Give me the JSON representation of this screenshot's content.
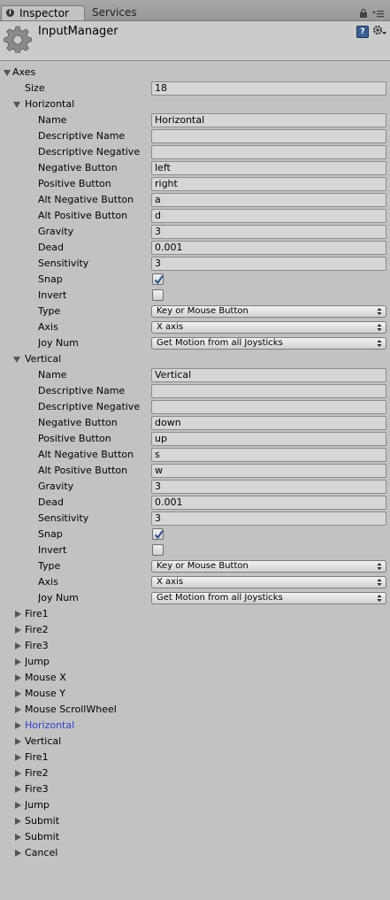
{
  "tabs": {
    "inspector": "Inspector",
    "services": "Services"
  },
  "header": {
    "title": "InputManager"
  },
  "axes": {
    "label": "Axes",
    "size_label": "Size",
    "size_value": "18",
    "expanded": [
      {
        "name": "Horizontal",
        "fields": {
          "name": "Horizontal",
          "descriptive_name": "",
          "descriptive_negative_name": "",
          "negative_button": "left",
          "positive_button": "right",
          "alt_negative_button": "a",
          "alt_positive_button": "d",
          "gravity": "3",
          "dead": "0.001",
          "sensitivity": "3",
          "snap": true,
          "invert": false,
          "type": "Key or Mouse Button",
          "axis": "X axis",
          "joy_num": "Get Motion from all Joysticks"
        }
      },
      {
        "name": "Vertical",
        "fields": {
          "name": "Vertical",
          "descriptive_name": "",
          "descriptive_negative_name": "",
          "negative_button": "down",
          "positive_button": "up",
          "alt_negative_button": "s",
          "alt_positive_button": "w",
          "gravity": "3",
          "dead": "0.001",
          "sensitivity": "3",
          "snap": true,
          "invert": false,
          "type": "Key or Mouse Button",
          "axis": "X axis",
          "joy_num": "Get Motion from all Joysticks"
        }
      }
    ],
    "collapsed": [
      "Fire1",
      "Fire2",
      "Fire3",
      "Jump",
      "Mouse X",
      "Mouse Y",
      "Mouse ScrollWheel",
      "Horizontal",
      "Vertical",
      "Fire1",
      "Fire2",
      "Fire3",
      "Jump",
      "Submit",
      "Submit",
      "Cancel"
    ],
    "active_collapsed_index": 7
  },
  "field_labels": {
    "name": "Name",
    "descriptive_name": "Descriptive Name",
    "descriptive_negative_name": "Descriptive Negative Name",
    "negative_button": "Negative Button",
    "positive_button": "Positive Button",
    "alt_negative_button": "Alt Negative Button",
    "alt_positive_button": "Alt Positive Button",
    "gravity": "Gravity",
    "dead": "Dead",
    "sensitivity": "Sensitivity",
    "snap": "Snap",
    "invert": "Invert",
    "type": "Type",
    "axis": "Axis",
    "joy_num": "Joy Num"
  },
  "colors": {
    "background": "#c2c2c2",
    "active_label": "#2c3fd0",
    "checkbox_check": "#2d4f8e"
  }
}
